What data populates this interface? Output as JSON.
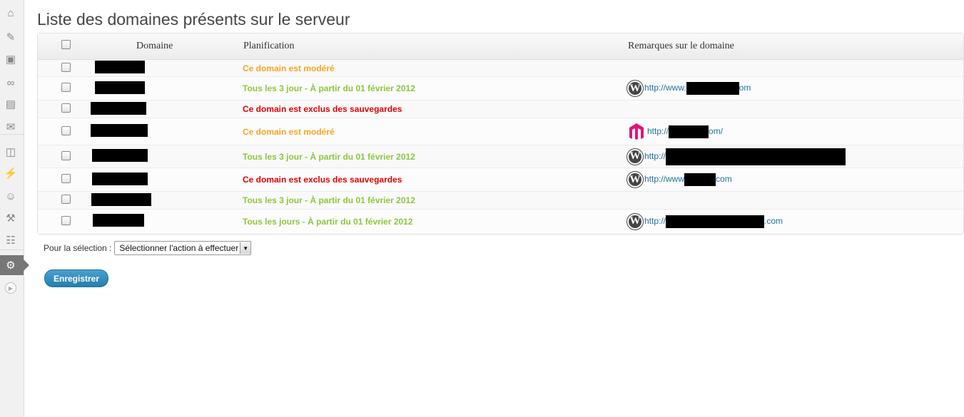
{
  "sidebar": {
    "items": [
      {
        "icon": "home-icon",
        "glyph": "⌂"
      },
      {
        "icon": "pin-icon",
        "glyph": "✎"
      },
      {
        "icon": "media-icon",
        "glyph": "▣"
      },
      {
        "icon": "links-icon",
        "glyph": "∞"
      },
      {
        "icon": "pages-icon",
        "glyph": "▤"
      },
      {
        "icon": "comments-icon",
        "glyph": "✉"
      },
      {
        "icon": "appearance-icon",
        "glyph": "◫"
      },
      {
        "icon": "plugins-icon",
        "glyph": "⚡"
      },
      {
        "icon": "users-icon",
        "glyph": "☺"
      },
      {
        "icon": "tools-icon",
        "glyph": "⚒"
      },
      {
        "icon": "settings-icon",
        "glyph": "☷"
      },
      {
        "icon": "gear-icon",
        "glyph": "⚙",
        "current": true
      }
    ],
    "collapse_icon": "collapse-arrow-icon"
  },
  "page": {
    "title": "Liste des domaines présents sur le serveur"
  },
  "table": {
    "headers": {
      "domain": "Domaine",
      "planning": "Planification",
      "remarks": "Remarques sur le domaine"
    },
    "rows": [
      {
        "domain": "[masqué]",
        "status": "moderated",
        "plan": "Ce domain est modéré",
        "cms": "",
        "url_prefix": "",
        "url_suffix": ""
      },
      {
        "domain": "[masqué]",
        "status": "schedule",
        "plan": "Tous les 3 jour - À partir du 01 février 2012",
        "cms": "wordpress",
        "url_prefix": "http://www.",
        "url_suffix": "om"
      },
      {
        "domain": "[masqué]",
        "status": "excluded",
        "plan": "Ce domain est exclus des sauvegardes",
        "cms": "",
        "url_prefix": "",
        "url_suffix": ""
      },
      {
        "domain": "[masqué]",
        "status": "moderated",
        "plan": "Ce domain est modéré",
        "cms": "magento",
        "url_prefix": "http://",
        "url_suffix": "om/"
      },
      {
        "domain": "[masqué]",
        "status": "schedule",
        "plan": "Tous les 3 jour - À partir du 01 février 2012",
        "cms": "wordpress",
        "url_prefix": "http://",
        "url_suffix": ""
      },
      {
        "domain": "[masqué]",
        "status": "excluded",
        "plan": "Ce domain est exclus des sauvegardes",
        "cms": "wordpress",
        "url_prefix": "http://www",
        "url_suffix": "com"
      },
      {
        "domain": "[masqué]",
        "status": "schedule",
        "plan": "Tous les 3 jour - À partir du 01 février 2012",
        "cms": "",
        "url_prefix": "",
        "url_suffix": ""
      },
      {
        "domain": "[masqué]",
        "status": "schedule",
        "plan": "Tous les jours - À partir du 01 février 2012",
        "cms": "wordpress",
        "url_prefix": "http://",
        "url_suffix": ".com"
      }
    ]
  },
  "bulk": {
    "label": "Pour la sélection :",
    "selected": "Sélectionner l'action à effectuer"
  },
  "save_label": "Enregistrer",
  "colors": {
    "moderated": "#f5a623",
    "schedule": "#8dc63f",
    "excluded": "#e00000",
    "link": "#21759b",
    "button": "#2e88b9"
  }
}
